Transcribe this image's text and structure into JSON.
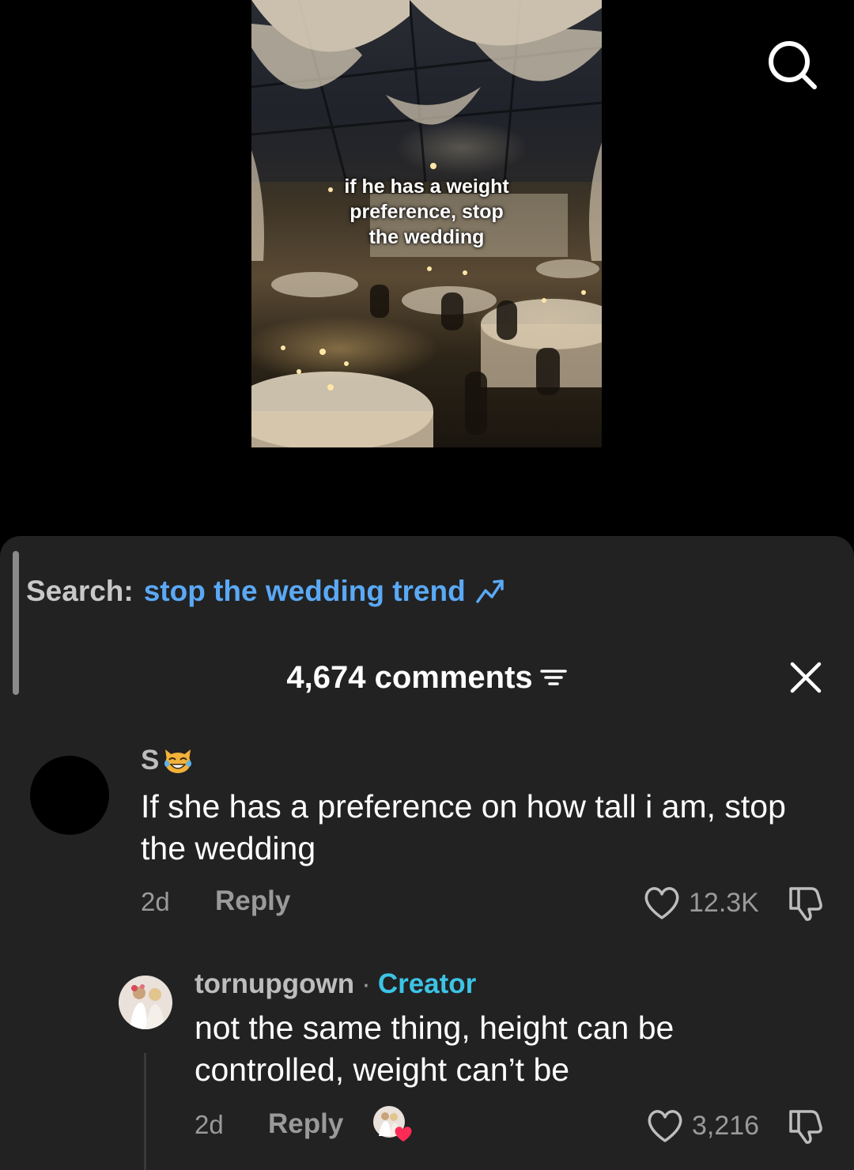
{
  "video": {
    "caption_lines": [
      "if he has a weight",
      "preference, stop",
      "the wedding"
    ]
  },
  "top_bar": {
    "search_icon": "search-icon"
  },
  "search_suggestion": {
    "label": "Search:",
    "query": "stop the wedding trend",
    "icon": "trending-icon"
  },
  "comments_header": {
    "count_label": "4,674 comments",
    "filter_icon": "filter-icon",
    "close_icon": "close-icon"
  },
  "comments": [
    {
      "username": "S",
      "username_emoji": "laughing-cat-emoji",
      "text": "If she has a preference on how tall i am, stop the wedding",
      "time": "2d",
      "reply_label": "Reply",
      "likes": "12.3K"
    }
  ],
  "reply": {
    "username": "tornupgown",
    "separator": "·",
    "badge": "Creator",
    "text": "not the same thing, height can be controlled, weight can’t be",
    "time": "2d",
    "reply_label": "Reply",
    "likes": "3,216",
    "creator_liked_icon": "creator-liked-heart-icon"
  },
  "colors": {
    "sheet_bg": "#222223",
    "search_query": "#5aa9f5",
    "creator_badge": "#3cc4e6",
    "muted_text": "#9a9a9a"
  }
}
